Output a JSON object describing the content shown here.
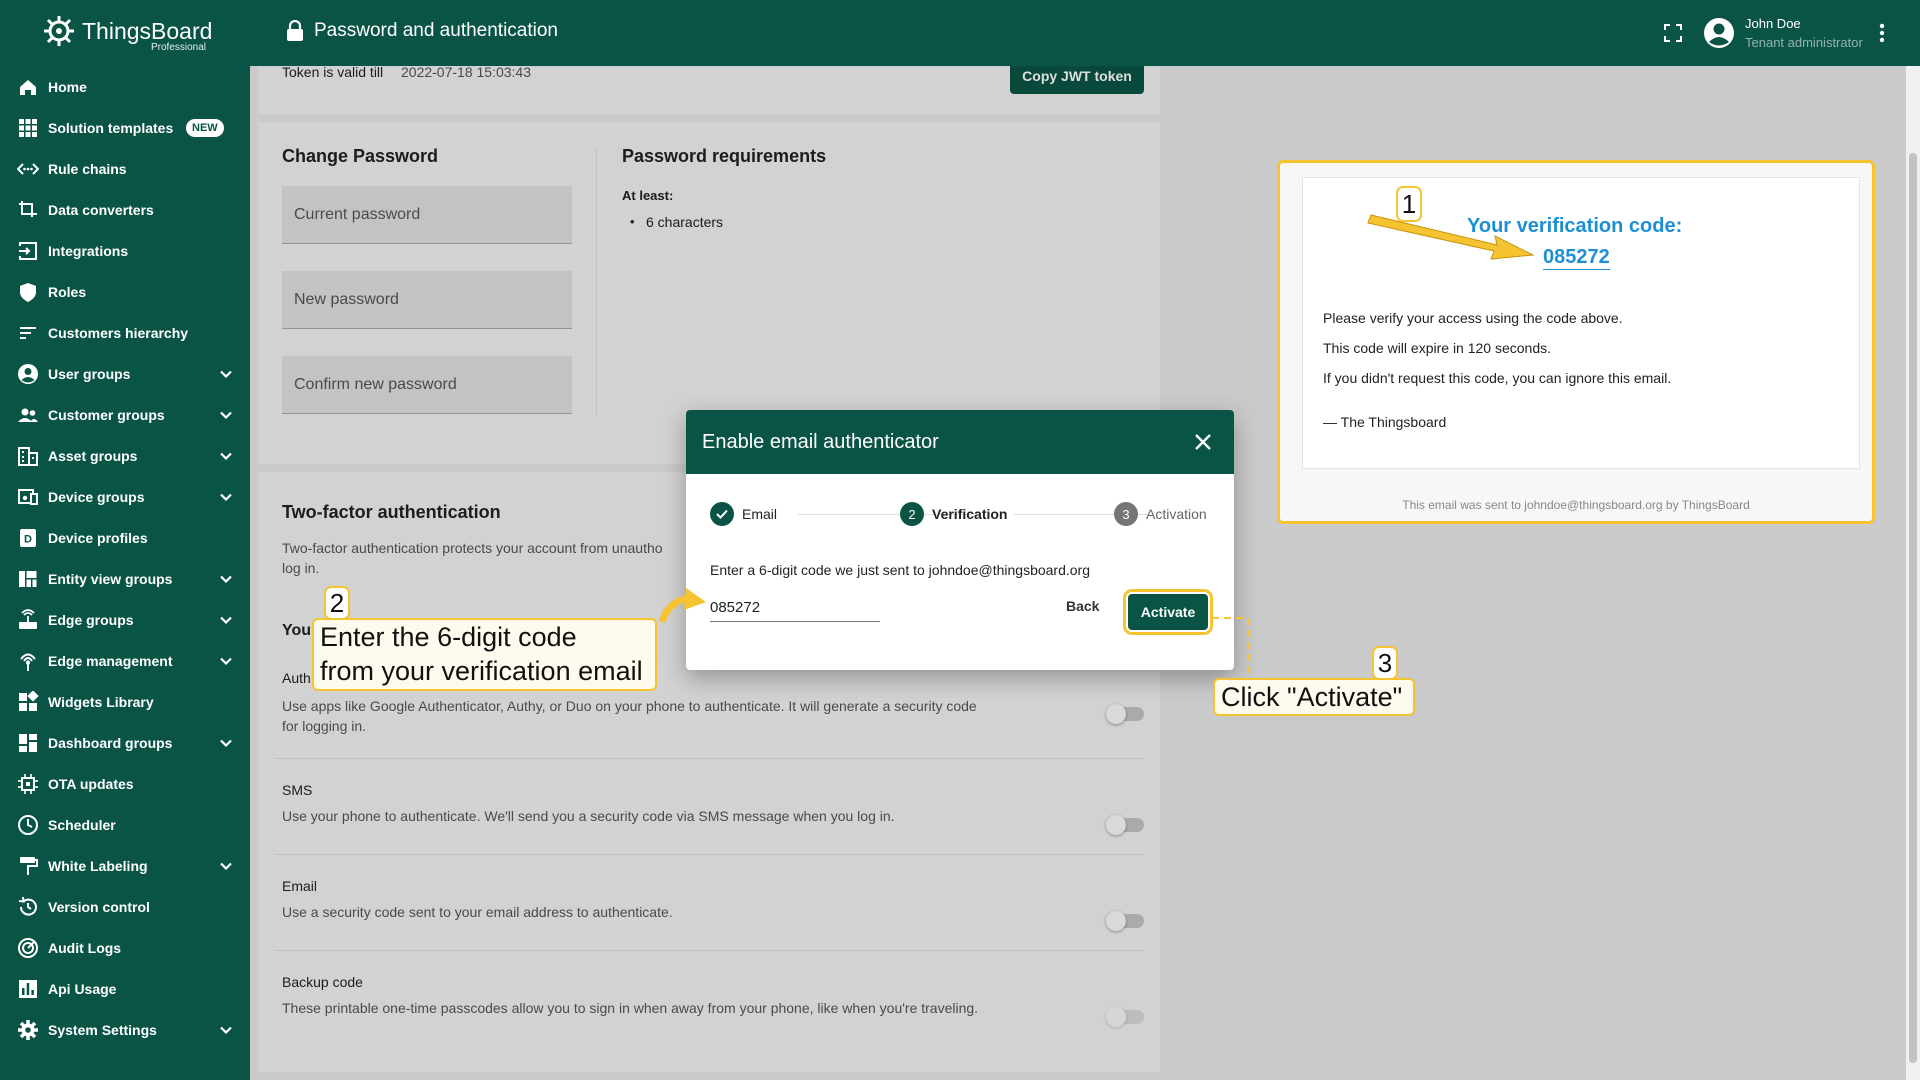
{
  "app": {
    "logo_text": "ThingsBoard",
    "logo_sub": "Professional",
    "page_title": "Password and authentication",
    "user_name": "John Doe",
    "user_role": "Tenant administrator"
  },
  "sidebar": {
    "items": [
      {
        "label": "Home",
        "icon": "home-icon",
        "chevron": false
      },
      {
        "label": "Solution templates",
        "icon": "apps-icon",
        "chevron": false,
        "badge": "NEW"
      },
      {
        "label": "Rule chains",
        "icon": "settings-ethernet-icon",
        "chevron": false
      },
      {
        "label": "Data converters",
        "icon": "transform-icon",
        "chevron": false
      },
      {
        "label": "Integrations",
        "icon": "input-icon",
        "chevron": false
      },
      {
        "label": "Roles",
        "icon": "security-icon",
        "chevron": false
      },
      {
        "label": "Customers hierarchy",
        "icon": "sort-icon",
        "chevron": false
      },
      {
        "label": "User groups",
        "icon": "account-circle-icon",
        "chevron": true
      },
      {
        "label": "Customer groups",
        "icon": "supervisor-account-icon",
        "chevron": true
      },
      {
        "label": "Asset groups",
        "icon": "domain-icon",
        "chevron": true
      },
      {
        "label": "Device groups",
        "icon": "devices-other-icon",
        "chevron": true
      },
      {
        "label": "Device profiles",
        "icon": "device-profile-icon",
        "chevron": false
      },
      {
        "label": "Entity view groups",
        "icon": "view-quilt-icon",
        "chevron": true
      },
      {
        "label": "Edge groups",
        "icon": "router-icon",
        "chevron": true
      },
      {
        "label": "Edge management",
        "icon": "settings-input-antenna-icon",
        "chevron": true
      },
      {
        "label": "Widgets Library",
        "icon": "widgets-icon",
        "chevron": false
      },
      {
        "label": "Dashboard groups",
        "icon": "dashboards-icon",
        "chevron": true
      },
      {
        "label": "OTA updates",
        "icon": "memory-icon",
        "chevron": false
      },
      {
        "label": "Scheduler",
        "icon": "schedule-icon",
        "chevron": false
      },
      {
        "label": "White Labeling",
        "icon": "format-paint-icon",
        "chevron": true
      },
      {
        "label": "Version control",
        "icon": "history-icon",
        "chevron": false
      },
      {
        "label": "Audit Logs",
        "icon": "track-changes-icon",
        "chevron": false
      },
      {
        "label": "Api Usage",
        "icon": "insert-chart-icon",
        "chevron": false
      },
      {
        "label": "System Settings",
        "icon": "settings-icon",
        "chevron": true
      }
    ]
  },
  "token": {
    "label": "Token is valid till",
    "value": "2022-07-18 15:03:43",
    "copy_button": "Copy JWT token"
  },
  "change_password": {
    "title": "Change Password",
    "current": "Current password",
    "new": "New password",
    "confirm": "Confirm new password",
    "req_title": "Password requirements",
    "req_at_least": "At least:",
    "req_item": "6 characters"
  },
  "two_factor": {
    "title": "Two-factor authentication",
    "desc_line1": "Two-factor authentication protects your account from unautho",
    "desc_line2": "log in.",
    "your_prefix": "You",
    "auth_prefix": "Auth",
    "auth_app_desc_line1": "Use apps like Google Authenticator, Authy, or Duo on your phone to authenticate. It will generate a security code",
    "auth_app_desc_line2": "for logging in.",
    "sms_title": "SMS",
    "sms_desc": "Use your phone to authenticate. We'll send you a security code via SMS message when you log in.",
    "email_title": "Email",
    "email_desc": "Use a security code sent to your email address to authenticate.",
    "backup_title": "Backup code",
    "backup_desc": "These printable one-time passcodes allow you to sign in when away from your phone, like when you're traveling."
  },
  "dialog": {
    "title": "Enable email authenticator",
    "steps": [
      {
        "num": "",
        "label": "Email",
        "state": "done"
      },
      {
        "num": "2",
        "label": "Verification",
        "state": "active"
      },
      {
        "num": "3",
        "label": "Activation",
        "state": "pending"
      }
    ],
    "instruction": "Enter a 6-digit code we just sent to johndoe@thingsboard.org",
    "code_value": "085272",
    "back": "Back",
    "activate": "Activate"
  },
  "email_preview": {
    "title": "Your verification code:",
    "code": "085272",
    "line1": "Please verify your access using the code above.",
    "line2": "This code will expire in 120 seconds.",
    "line3": "If you didn't request this code, you can ignore this email.",
    "signature": "— The Thingsboard",
    "footer": "This email was sent to johndoe@thingsboard.org by ThingsBoard"
  },
  "annotations": {
    "num1": "1",
    "num2": "2",
    "num3": "3",
    "text2_line1": "Enter the 6-digit code",
    "text2_line2": "from your verification email",
    "text3": "Click \"Activate\""
  },
  "colors": {
    "brand": "#0a5446",
    "highlight": "#f5c430",
    "email_blue": "#1e8fd6"
  }
}
